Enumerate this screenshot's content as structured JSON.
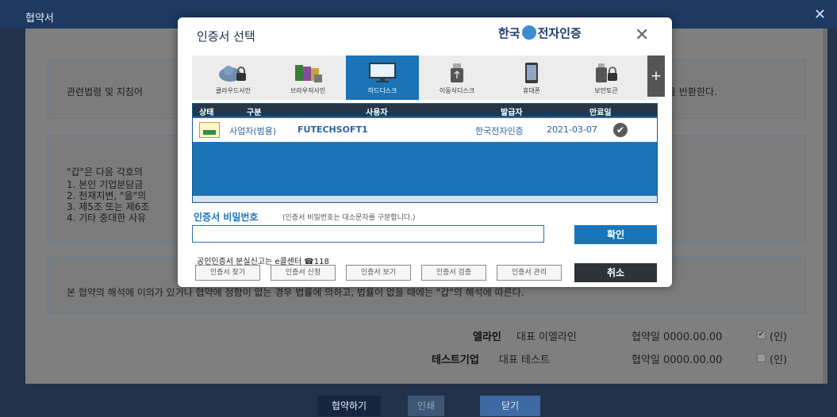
{
  "window": {
    "title": "협약서",
    "close_glyph": "✕"
  },
  "contract": {
    "para1": "관련법령 및 지침어",
    "para1_tail": "금을 반환한다.",
    "para2_head": "\"갑\"은 다음 각호의",
    "items": [
      "1. 본인 기업분담금",
      "2. 천재지변, \"을\"의",
      "3. 제5조 또는 제6조",
      "4. 기타 중대한 사유"
    ],
    "para3": "본 협약의 해석에 이의가 있거나 협약에 정함이 없는 경우 법률에 의하고, 법률이 없을 때에는 \"갑\"의 해석에 따른다.",
    "signatures": [
      {
        "company": "엘라인",
        "rep": "대표 이엘라인",
        "date": "협약일 0000.00.00",
        "checked": true,
        "seal": "(인)"
      },
      {
        "company": "테스트기업",
        "rep": "대표 테스트",
        "date": "협약일 0000.00.00",
        "checked": false,
        "seal": "(인)"
      }
    ]
  },
  "footer": {
    "sign_button": "협약하기",
    "print_button": "인쇄",
    "close_button": "닫기"
  },
  "dialog": {
    "title": "인증서 선택",
    "brand": "한국전자인증",
    "brand_prefix": "한국",
    "brand_suffix": "전자인증",
    "close_glyph": "✕",
    "tabs": [
      {
        "label": "클라우드사인",
        "icon": "cloud-lock-icon",
        "active": false
      },
      {
        "label": "브라우저사인",
        "icon": "browser-cert-icon",
        "active": false
      },
      {
        "label": "하드디스크",
        "icon": "monitor-icon",
        "active": true
      },
      {
        "label": "이동식디스크",
        "icon": "usb-drive-icon",
        "active": false
      },
      {
        "label": "휴대폰",
        "icon": "phone-icon",
        "active": false
      },
      {
        "label": "보안토큰",
        "icon": "security-token-icon",
        "active": false
      }
    ],
    "more_tabs": "+",
    "table": {
      "headers": [
        "상태",
        "구분",
        "사용자",
        "발급자",
        "만료일"
      ],
      "rows": [
        {
          "type": "사업자(범용)",
          "user": "FUTECHSOFT1",
          "issuer": "한국전자인증",
          "expiry": "2021-03-07"
        }
      ]
    },
    "password_label": "인증서 비밀번호",
    "password_hint": "(인증서 비밀번호는 대소문자를 구분합니다.)",
    "password_value": "",
    "ok_button": "확인",
    "loss_note": "공인인증서 분실신고는 e콜센터 ☎118",
    "sub_buttons": [
      "인증서 찾기",
      "인증서 신청",
      "인증서 보기",
      "인증서 검증",
      "인증서 관리"
    ],
    "cancel_button": "취소"
  },
  "colors": {
    "accent_blue": "#1a74b6",
    "title_bar": "#1e3a62",
    "dark_button": "#2f3337"
  }
}
